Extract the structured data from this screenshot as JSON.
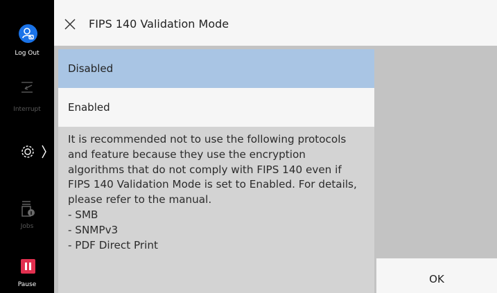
{
  "sidebar": {
    "logout_label": "Log Out",
    "interrupt_label": "Interrupt",
    "jobs_label": "Jobs",
    "pause_label": "Pause"
  },
  "dialog": {
    "title": "FIPS 140 Validation Mode",
    "options": [
      {
        "label": "Disabled",
        "selected": true
      },
      {
        "label": "Enabled",
        "selected": false
      }
    ],
    "message_lines": [
      "It is recommended not to use the following protocols",
      "and feature because they use the encryption",
      "algorithms that do not comply with FIPS 140 even if",
      "FIPS 140 Validation Mode is set to Enabled. For details,",
      "please refer to the manual.",
      "- SMB",
      "- SNMPv3",
      "- PDF Direct Print"
    ],
    "ok_label": "OK"
  },
  "colors": {
    "selected_option": "#a9c5e4",
    "logout_accent": "#1a73e8",
    "pause_accent": "#e2304f"
  }
}
